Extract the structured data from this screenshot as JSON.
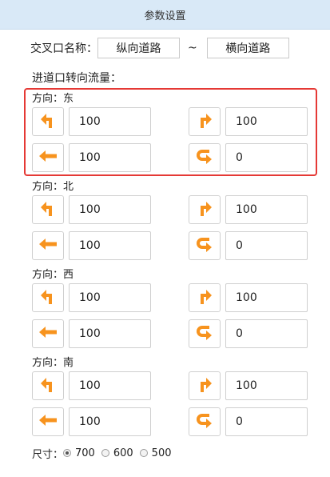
{
  "header": {
    "title": "参数设置"
  },
  "road_names": {
    "label": "交叉口名称：",
    "vertical": "纵向道路",
    "separator": "~",
    "horizontal": "横向道路"
  },
  "flow_section": {
    "label": "进道口转向流量："
  },
  "directions": [
    {
      "label": "方向：东",
      "left": "100",
      "right": "100",
      "straight": "100",
      "uturn": "0"
    },
    {
      "label": "方向：北",
      "left": "100",
      "right": "100",
      "straight": "100",
      "uturn": "0"
    },
    {
      "label": "方向：西",
      "left": "100",
      "right": "100",
      "straight": "100",
      "uturn": "0"
    },
    {
      "label": "方向：南",
      "left": "100",
      "right": "100",
      "straight": "100",
      "uturn": "0"
    }
  ],
  "size": {
    "label": "尺寸：",
    "options": [
      "700",
      "600",
      "500"
    ],
    "selected": "700"
  },
  "colors": {
    "arrow": "#f7931e",
    "highlight": "#e53935",
    "header_bg": "#d9e9f7"
  },
  "icons": [
    "turn-left-icon",
    "turn-right-icon",
    "straight-left-icon",
    "u-turn-icon"
  ]
}
